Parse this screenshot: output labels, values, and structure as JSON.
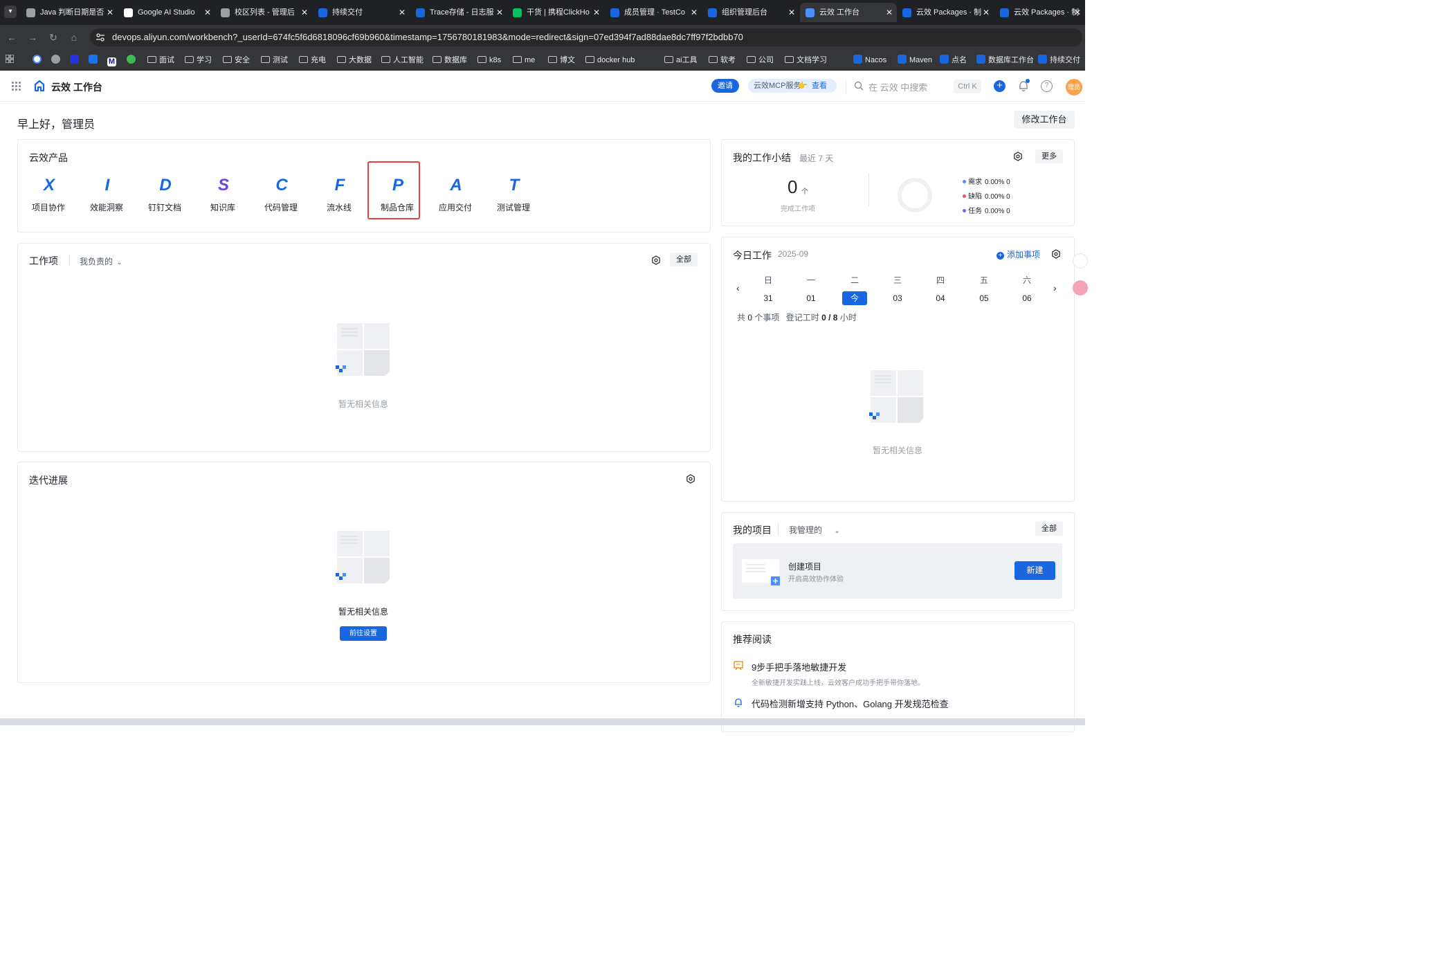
{
  "browser": {
    "tabs": [
      {
        "title": "Java 判断日期是否",
        "color": "#9aa0a6"
      },
      {
        "title": "Google AI Studio",
        "color": "#ffffff"
      },
      {
        "title": "校区列表 - 管理后",
        "color": "#9aa0a6"
      },
      {
        "title": "持续交付",
        "color": "#1867e0"
      },
      {
        "title": "Trace存储 - 日志服",
        "color": "#1867e0"
      },
      {
        "title": "干货 | 携程ClickHo",
        "color": "#07c160"
      },
      {
        "title": "成员管理 · TestCo",
        "color": "#1867e0"
      },
      {
        "title": "组织管理后台",
        "color": "#1867e0"
      },
      {
        "title": "云效 工作台",
        "color": "#4a90ff"
      },
      {
        "title": "云效 Packages · 制",
        "color": "#1867e0"
      },
      {
        "title": "云效 Packages · 制",
        "color": "#1867e0"
      }
    ],
    "url": "devops.aliyun.com/workbench?_userId=674fc5f6d6818096cf69b960&timestamp=1756780181983&mode=redirect&sign=07ed394f7ad88dae8dc7ff97f2bdbb70",
    "bookmarks": [
      {
        "label": "面试",
        "type": "folder"
      },
      {
        "label": "学习",
        "type": "folder"
      },
      {
        "label": "安全",
        "type": "folder"
      },
      {
        "label": "测试",
        "type": "folder"
      },
      {
        "label": "充电",
        "type": "folder"
      },
      {
        "label": "大数据",
        "type": "folder"
      },
      {
        "label": "人工智能",
        "type": "folder"
      },
      {
        "label": "数据库",
        "type": "folder"
      },
      {
        "label": "k8s",
        "type": "folder"
      },
      {
        "label": "me",
        "type": "folder"
      },
      {
        "label": "博文",
        "type": "folder"
      },
      {
        "label": "docker hub",
        "type": "folder"
      },
      {
        "label": "ai工具",
        "type": "folder"
      },
      {
        "label": "软考",
        "type": "folder"
      },
      {
        "label": "公司",
        "type": "folder"
      },
      {
        "label": "文档学习",
        "type": "folder"
      },
      {
        "label": "Nacos",
        "type": "link"
      },
      {
        "label": "Maven",
        "type": "link"
      },
      {
        "label": "点名",
        "type": "link"
      },
      {
        "label": "数据库工作台",
        "type": "link"
      },
      {
        "label": "持续交付",
        "type": "link"
      }
    ]
  },
  "header": {
    "title": "云效 工作台",
    "invite": "邀请",
    "mcp_label": "云效MCP服务",
    "mcp_view": "查看",
    "search_placeholder": "在 云效 中搜索",
    "shortcut": "Ctrl K",
    "avatar_text": "理员"
  },
  "greeting": "早上好，管理员",
  "edit_workbench": "修改工作台",
  "products": {
    "title": "云效产品",
    "items": [
      {
        "label": "项目协作",
        "glyph": "X",
        "color": "#1867e0"
      },
      {
        "label": "效能洞察",
        "glyph": "I",
        "color": "#1867e0"
      },
      {
        "label": "钉钉文档",
        "glyph": "D",
        "color": "#1867e0"
      },
      {
        "label": "知识库",
        "glyph": "S",
        "color": "#6e44d8"
      },
      {
        "label": "代码管理",
        "glyph": "C",
        "color": "#1867e0"
      },
      {
        "label": "流水线",
        "glyph": "F",
        "color": "#1867e0"
      },
      {
        "label": "制品仓库",
        "glyph": "P",
        "color": "#1867e0"
      },
      {
        "label": "应用交付",
        "glyph": "A",
        "color": "#1867e0"
      },
      {
        "label": "测试管理",
        "glyph": "T",
        "color": "#1867e0"
      }
    ]
  },
  "work_items": {
    "title": "工作项",
    "filter": "我负责的",
    "all": "全部",
    "empty": "暂无相关信息"
  },
  "iterations": {
    "title": "迭代进展",
    "empty": "暂无相关信息",
    "goto_settings": "前往设置"
  },
  "summary": {
    "title": "我的工作小结",
    "range": "最近 7 天",
    "more": "更多",
    "count": "0",
    "unit": "个",
    "count_label": "完成工作项",
    "legend": [
      {
        "label": "需求",
        "value": "0.00% 0",
        "color": "#4a90ff"
      },
      {
        "label": "缺陷",
        "value": "0.00% 0",
        "color": "#f0506e"
      },
      {
        "label": "任务",
        "value": "0.00% 0",
        "color": "#8a5cf5"
      }
    ]
  },
  "today": {
    "title": "今日工作",
    "month": "2025-09",
    "add": "添加事项",
    "weekdays": [
      "日",
      "一",
      "二",
      "三",
      "四",
      "五",
      "六"
    ],
    "dates": [
      "31",
      "01",
      "今",
      "03",
      "04",
      "05",
      "06"
    ],
    "today_index": 2,
    "total_prefix": "共",
    "total_count": "0",
    "total_suffix": "个事项",
    "hours_prefix": "登记工时",
    "hours_value": "0 / 8",
    "hours_suffix": "小时",
    "empty": "暂无相关信息"
  },
  "projects": {
    "title": "我的项目",
    "filter": "我管理的",
    "all": "全部",
    "create_title": "创建项目",
    "create_sub": "开启高效协作体验",
    "new_btn": "新建"
  },
  "reading": {
    "title": "推荐阅读",
    "items": [
      {
        "title": "9步手把手落地敏捷开发",
        "sub": "全新敏捷开发实践上线，云效客户成功手把手带你落地。"
      },
      {
        "title": "代码检测新增支持 Python、Golang 开发规范检查",
        "sub": ""
      }
    ]
  }
}
